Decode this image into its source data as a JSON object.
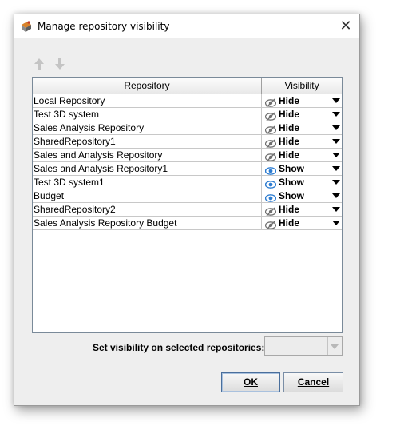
{
  "window": {
    "title": "Manage repository visibility",
    "close_glyph": "✕"
  },
  "toolbar": {
    "move_up_icon": "arrow-up-icon",
    "move_down_icon": "arrow-down-icon"
  },
  "table": {
    "columns": [
      "Repository",
      "Visibility"
    ],
    "rows": [
      {
        "name": "Local Repository",
        "visibility": "Hide"
      },
      {
        "name": "Test 3D system",
        "visibility": "Hide"
      },
      {
        "name": "Sales Analysis Repository",
        "visibility": "Hide"
      },
      {
        "name": "SharedRepository1",
        "visibility": "Hide"
      },
      {
        "name": "Sales and Analysis Repository",
        "visibility": "Hide"
      },
      {
        "name": "Sales and Analysis Repository1",
        "visibility": "Show"
      },
      {
        "name": "Test 3D system1",
        "visibility": "Show"
      },
      {
        "name": "Budget",
        "visibility": "Show"
      },
      {
        "name": "SharedRepository2",
        "visibility": "Hide"
      },
      {
        "name": "Sales Analysis Repository Budget",
        "visibility": "Hide"
      }
    ]
  },
  "set_visibility": {
    "label": "Set visibility on selected repositories:",
    "value": ""
  },
  "buttons": {
    "ok_label": "OK",
    "cancel_label": "Cancel"
  },
  "colors": {
    "show_eye": "#2b7bd0",
    "hide_eye": "#707070",
    "dialog_bg": "#eeeeee"
  }
}
